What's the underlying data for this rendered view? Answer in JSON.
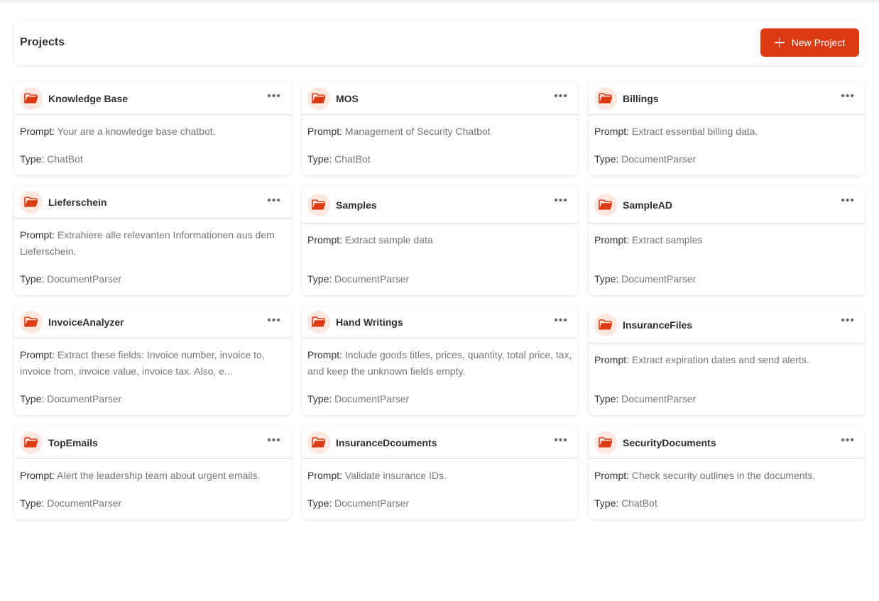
{
  "header": {
    "title": "Projects",
    "new_button_label": "New Project"
  },
  "labels": {
    "prompt": "Prompt:",
    "type": "Type:"
  },
  "colors": {
    "accent": "#dc3a12",
    "icon_bg": "#fde7df"
  },
  "projects": [
    {
      "name": "Knowledge Base",
      "prompt": "Your are a knowledge base chatbot.",
      "type": "ChatBot"
    },
    {
      "name": "MOS",
      "prompt": "Management of Security Chatbot",
      "type": "ChatBot"
    },
    {
      "name": "Billings",
      "prompt": "Extract essential billing data.",
      "type": "DocumentParser"
    },
    {
      "name": "Lieferschein",
      "prompt": "Extrahiere alle relevanten Informationen aus dem Lieferschein.",
      "type": "DocumentParser"
    },
    {
      "name": "Samples",
      "prompt": "Extract sample data",
      "type": "DocumentParser"
    },
    {
      "name": "SampleAD",
      "prompt": "Extract samples",
      "type": "DocumentParser"
    },
    {
      "name": "InvoiceAnalyzer",
      "prompt": "Extract these fields: Invoice number, invoice to, invoice from, invoice value, invoice tax. Also, e...",
      "type": "DocumentParser"
    },
    {
      "name": "Hand Writings",
      "prompt": "Include goods titles, prices, quantity, total price, tax, and keep the unknown fields empty.",
      "type": "DocumentParser"
    },
    {
      "name": "InsuranceFiles",
      "prompt": "Extract expiration dates and send alerts.",
      "type": "DocumentParser"
    },
    {
      "name": "TopEmails",
      "prompt": "Alert the leadership team about urgent emails.",
      "type": "DocumentParser"
    },
    {
      "name": "InsuranceDcouments",
      "prompt": "Validate insurance IDs.",
      "type": "DocumentParser"
    },
    {
      "name": "SecurityDocuments",
      "prompt": "Check security outlines in the documents.",
      "type": "ChatBot"
    }
  ]
}
